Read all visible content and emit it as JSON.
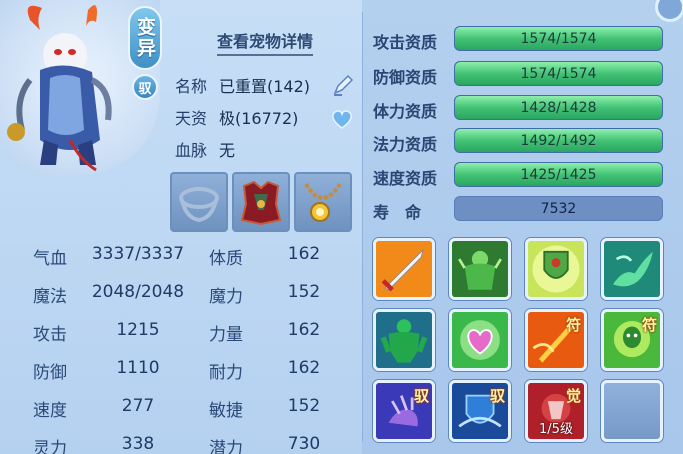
{
  "header": {
    "variant_badge": "变异",
    "tame_badge": "驭",
    "detail_link": "查看宠物详情"
  },
  "info": {
    "name_label": "名称",
    "name_value": "已重置(142)",
    "talent_label": "天资",
    "talent_value": "极(16772)",
    "bloodline_label": "血脉",
    "bloodline_value": "无"
  },
  "stats": [
    {
      "label1": "气血",
      "value1": "3337/3337",
      "label2": "体质",
      "value2": "162"
    },
    {
      "label1": "魔法",
      "value1": "2048/2048",
      "label2": "魔力",
      "value2": "152"
    },
    {
      "label1": "攻击",
      "value1": "1215",
      "label2": "力量",
      "value2": "162"
    },
    {
      "label1": "防御",
      "value1": "1110",
      "label2": "耐力",
      "value2": "162"
    },
    {
      "label1": "速度",
      "value1": "277",
      "label2": "敏捷",
      "value2": "152"
    },
    {
      "label1": "灵力",
      "value1": "338",
      "label2": "潜力",
      "value2": "730"
    }
  ],
  "aptitudes": [
    {
      "label": "攻击资质",
      "value": "1574/1574",
      "fill": 1.0
    },
    {
      "label": "防御资质",
      "value": "1574/1574",
      "fill": 1.0
    },
    {
      "label": "体力资质",
      "value": "1428/1428",
      "fill": 1.0
    },
    {
      "label": "法力资质",
      "value": "1492/1492",
      "fill": 1.0
    },
    {
      "label": "速度资质",
      "value": "1425/1425",
      "fill": 1.0
    }
  ],
  "lifespan": {
    "label": "寿　命",
    "value": "7532"
  },
  "skills": {
    "row3_tags": {
      "s1": "驭",
      "s2": "驭",
      "s3": "觉"
    },
    "row2_tags": {
      "s3": "符",
      "s4": "符"
    },
    "awaken_level": "1/5级"
  },
  "colors": {
    "aptitude_fill": "#43c376",
    "panel_bg": "#b5d1f0",
    "text": "#2c4b78"
  },
  "equipment": [
    "collar",
    "armor",
    "amulet"
  ]
}
